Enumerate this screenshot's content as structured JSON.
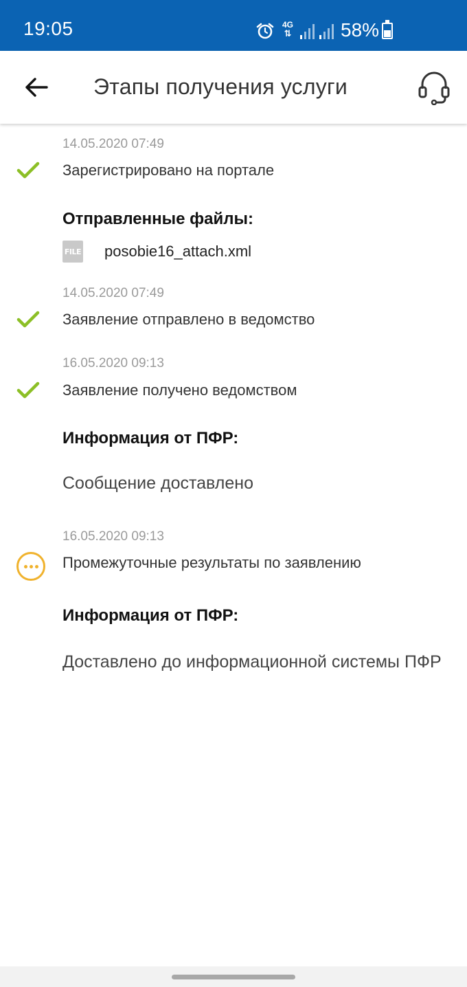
{
  "status_bar": {
    "time": "19:05",
    "network": "4G",
    "battery_percent": "58%",
    "battery_level": 0.58,
    "icons": [
      "alarm-icon",
      "network-4g-icon",
      "signal-icon",
      "signal-icon",
      "battery-icon"
    ]
  },
  "app_bar": {
    "title": "Этапы получения услуги",
    "back_icon": "arrow-left-icon",
    "support_icon": "headset-icon"
  },
  "timeline": [
    {
      "date": "14.05.2020 07:49",
      "text": "Зарегистрировано на портале",
      "status_icon": "check-icon",
      "files_heading": "Отправленные файлы:",
      "file_badge": "FILE",
      "file_name": "posobie16_attach.xml"
    },
    {
      "date": "14.05.2020 07:49",
      "text": "Заявление отправлено в ведомство",
      "status_icon": "check-icon"
    },
    {
      "date": "16.05.2020 09:13",
      "text": "Заявление получено ведомством",
      "status_icon": "check-icon",
      "info_heading": "Информация от ПФР:",
      "info_text": "Сообщение доставлено"
    },
    {
      "date": "16.05.2020 09:13",
      "text": "Промежуточные результаты по заявлению",
      "status_icon": "pending-icon",
      "info_heading": "Информация от ПФР:",
      "info_text": "Доставлено до информационной системы ПФР"
    }
  ],
  "colors": {
    "status_bar": "#0b63b3",
    "check": "#8cbf26",
    "pending": "#f0b22d"
  }
}
